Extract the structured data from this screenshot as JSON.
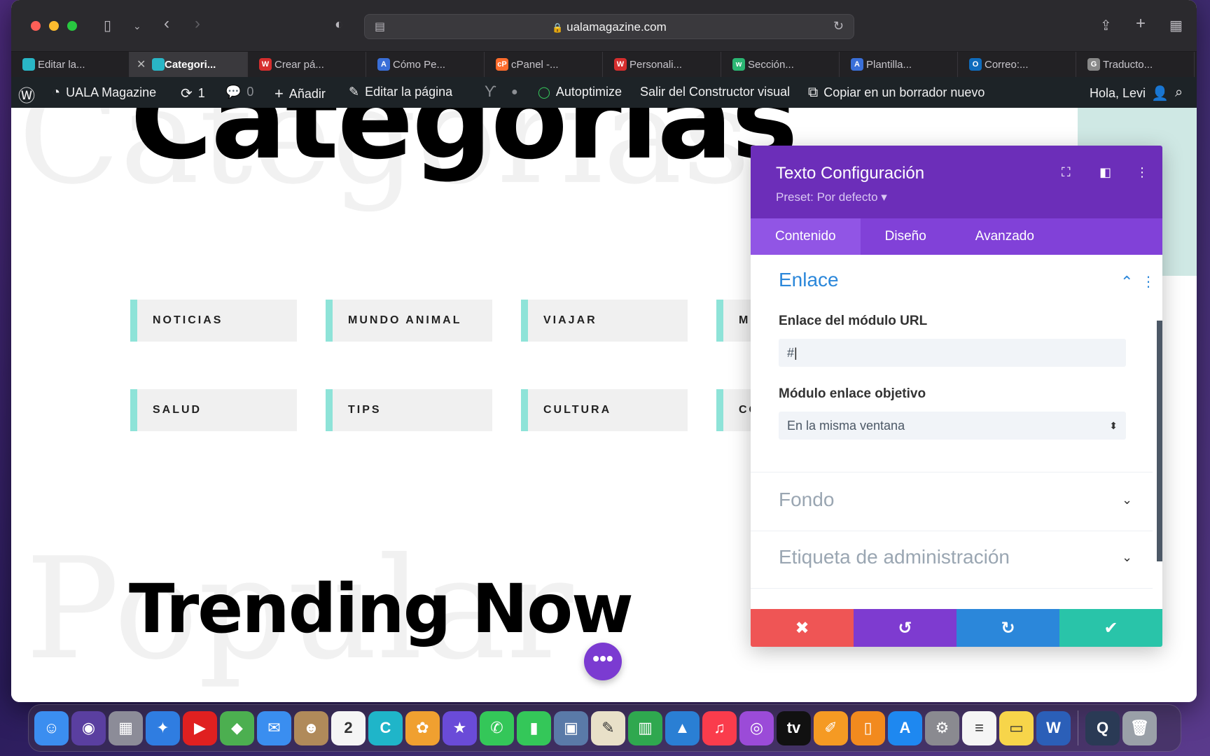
{
  "browser": {
    "url": "ualamagazine.com",
    "tabs": [
      {
        "label": "Editar la...",
        "favicon_color": "#29b6c6",
        "favicon_glyph": ""
      },
      {
        "label": "Categori...",
        "favicon_color": "#29b6c6",
        "favicon_glyph": "",
        "active": true
      },
      {
        "label": "Crear pá...",
        "favicon_color": "#d62e2e",
        "favicon_glyph": "W"
      },
      {
        "label": "Cómo Pe...",
        "favicon_color": "#3a6fd8",
        "favicon_glyph": "A"
      },
      {
        "label": "cPanel -...",
        "favicon_color": "#ff6c2c",
        "favicon_glyph": "cP"
      },
      {
        "label": "Personali...",
        "favicon_color": "#d62e2e",
        "favicon_glyph": "W"
      },
      {
        "label": "Sección...",
        "favicon_color": "#2bb673",
        "favicon_glyph": "w"
      },
      {
        "label": "Plantilla...",
        "favicon_color": "#3a6fd8",
        "favicon_glyph": "A"
      },
      {
        "label": "Correo:...",
        "favicon_color": "#0f6cbd",
        "favicon_glyph": "O"
      },
      {
        "label": "Traducto...",
        "favicon_color": "#888888",
        "favicon_glyph": "G"
      }
    ]
  },
  "adminbar": {
    "site_name": "UALA Magazine",
    "updates_count": "1",
    "comments_count": "0",
    "add_label": "Añadir",
    "edit_page_label": "Editar la página",
    "autoptimize_label": "Autoptimize",
    "exit_builder_label": "Salir del Constructor visual",
    "copy_draft_label": "Copiar en un borrador nuevo",
    "greeting": "Hola, Levi"
  },
  "page": {
    "heading_top": "Categorías",
    "ghost_top": "Categorías",
    "categories_row1": [
      "NOTICIAS",
      "MUNDO ANIMAL",
      "VIAJAR",
      "M..."
    ],
    "categories_row2": [
      "SALUD",
      "TIPS",
      "CULTURA",
      "CO..."
    ],
    "heading_bottom": "Trending Now",
    "ghost_bottom": "Popular",
    "fab_glyph": "•••"
  },
  "modal": {
    "title": "Texto Configuración",
    "preset": "Preset: Por defecto ▾",
    "tabs": [
      "Contenido",
      "Diseño",
      "Avanzado"
    ],
    "section_link": "Enlace",
    "url_label": "Enlace del módulo URL",
    "url_value": "#",
    "target_label": "Módulo enlace objetivo",
    "target_value": "En la misma ventana",
    "section_background": "Fondo",
    "section_admin": "Etiqueta de administración"
  },
  "colors": {
    "modal_header": "#6c2eb9",
    "modal_tabs": "#8141d8",
    "cancel": "#ef5555",
    "undo": "#7e3bd0",
    "redo": "#2b87da",
    "save": "#29c4a9",
    "accent_link": "#2b87da"
  },
  "dock": {
    "apps": [
      {
        "name": "finder-icon",
        "color": "#3b8ef0",
        "glyph": "☺"
      },
      {
        "name": "siri-icon",
        "color": "#5a3fa0",
        "glyph": "◉"
      },
      {
        "name": "launchpad-icon",
        "color": "#8c8c98",
        "glyph": "▦"
      },
      {
        "name": "safari-icon",
        "color": "#2f7de1",
        "glyph": "✦"
      },
      {
        "name": "youtube-icon",
        "color": "#e02020",
        "glyph": "▶"
      },
      {
        "name": "maps-icon",
        "color": "#4caf50",
        "glyph": "◆"
      },
      {
        "name": "mail-icon",
        "color": "#3a8ef0",
        "glyph": "✉"
      },
      {
        "name": "contacts-icon",
        "color": "#b08a5a",
        "glyph": "☻"
      },
      {
        "name": "calendar-icon",
        "color": "#f5f5f5",
        "glyph": "2"
      },
      {
        "name": "canva-icon",
        "color": "#1fb5c9",
        "glyph": "C"
      },
      {
        "name": "photos-icon",
        "color": "#f0a030",
        "glyph": "✿"
      },
      {
        "name": "imovie-icon",
        "color": "#6a4bd8",
        "glyph": "★"
      },
      {
        "name": "messages-icon",
        "color": "#34c759",
        "glyph": "✆"
      },
      {
        "name": "facetime-icon",
        "color": "#34c759",
        "glyph": "▮"
      },
      {
        "name": "preview-icon",
        "color": "#5a7aa8",
        "glyph": "▣"
      },
      {
        "name": "textedit-icon",
        "color": "#e8e0c8",
        "glyph": "✎"
      },
      {
        "name": "numbers-icon",
        "color": "#2fa84f",
        "glyph": "▥"
      },
      {
        "name": "keynote-icon",
        "color": "#2a7fd4",
        "glyph": "▲"
      },
      {
        "name": "music-icon",
        "color": "#fa3c4c",
        "glyph": "♫"
      },
      {
        "name": "podcasts-icon",
        "color": "#9b4bd8",
        "glyph": "◎"
      },
      {
        "name": "appletv-icon",
        "color": "#111111",
        "glyph": "tv"
      },
      {
        "name": "pages-icon",
        "color": "#f59a23",
        "glyph": "✐"
      },
      {
        "name": "books-icon",
        "color": "#f28a1e",
        "glyph": "▯"
      },
      {
        "name": "appstore-icon",
        "color": "#1e88f0",
        "glyph": "A"
      },
      {
        "name": "system-preferences-icon",
        "color": "#8a8a90",
        "glyph": "⚙"
      },
      {
        "name": "reminders-icon",
        "color": "#f5f5f5",
        "glyph": "≡"
      },
      {
        "name": "notes-icon",
        "color": "#f7d54a",
        "glyph": "▭"
      },
      {
        "name": "word-icon",
        "color": "#2b5fb8",
        "glyph": "W"
      },
      {
        "name": "quicktime-icon",
        "color": "#2a3a55",
        "glyph": "Q"
      },
      {
        "name": "trash-icon",
        "color": "#9aa0a8",
        "glyph": "🗑"
      }
    ]
  }
}
